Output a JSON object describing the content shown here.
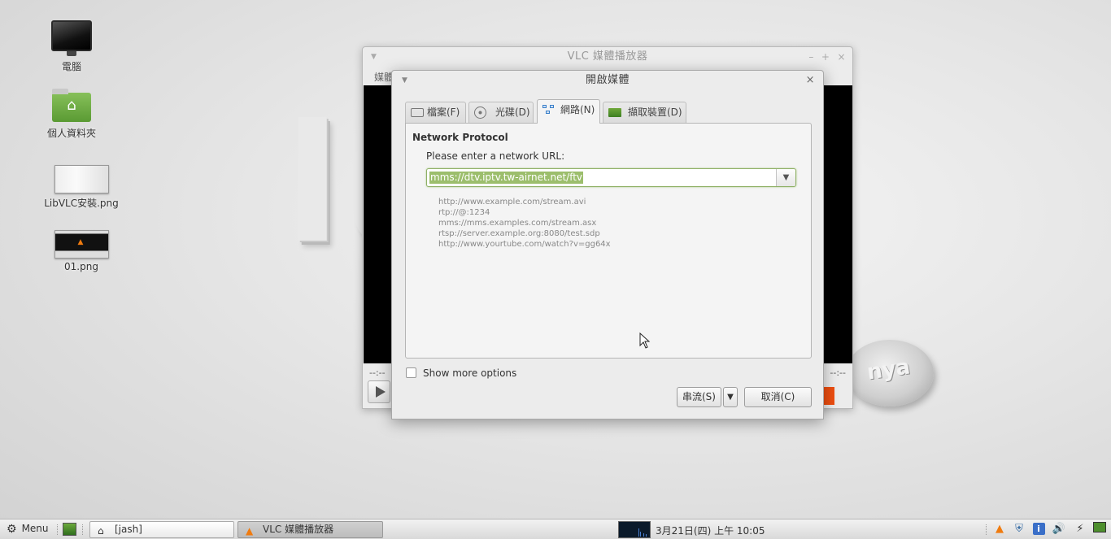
{
  "desktop": {
    "icons": [
      {
        "label": "電腦",
        "icon": "computer-icon"
      },
      {
        "label": "個人資料夾",
        "icon": "home-folder-icon"
      },
      {
        "label": "LibVLC安裝.png",
        "icon": "image-file-icon"
      },
      {
        "label": "01.png",
        "icon": "image-file-icon"
      }
    ]
  },
  "vlc_main": {
    "title": "VLC 媒體播放器",
    "menu_first": "媒體",
    "time_elapsed": "--:--",
    "time_total": "--:--"
  },
  "open_media": {
    "title": "開啟媒體",
    "tabs": [
      {
        "label": "檔案(F)",
        "active": false,
        "icon": "folder-icon"
      },
      {
        "label": "光碟(D)",
        "active": false,
        "icon": "disc-icon"
      },
      {
        "label": "網路(N)",
        "active": true,
        "icon": "network-icon"
      },
      {
        "label": "擷取裝置(D)",
        "active": false,
        "icon": "capture-card-icon"
      }
    ],
    "section_title": "Network Protocol",
    "url_prompt": "Please enter a network URL:",
    "url_value": "mms://dtv.iptv.tw-airnet.net/ftv",
    "examples": [
      "http://www.example.com/stream.avi",
      "rtp://@:1234",
      "mms://mms.examples.com/stream.asx",
      "rtsp://server.example.org:8080/test.sdp",
      "http://www.yourtube.com/watch?v=gg64x"
    ],
    "show_more_options": "Show more options",
    "show_more_checked": false,
    "stream_button": "串流(S)",
    "cancel_button": "取消(C)"
  },
  "taskbar": {
    "menu_label": "Menu",
    "windows": [
      {
        "label": "[jash]",
        "icon": "home-icon",
        "active": false
      },
      {
        "label": "VLC 媒體播放器",
        "icon": "vlc-icon",
        "active": true
      }
    ],
    "clock": "3月21日(四) 上午 10:05",
    "tray_icons": [
      "vlc-icon",
      "shield-icon",
      "info-icon",
      "volume-icon",
      "network-icon",
      "display-icon"
    ]
  },
  "colors": {
    "selection": "#9cbe6c",
    "vlc_orange": "#f07b0f"
  }
}
